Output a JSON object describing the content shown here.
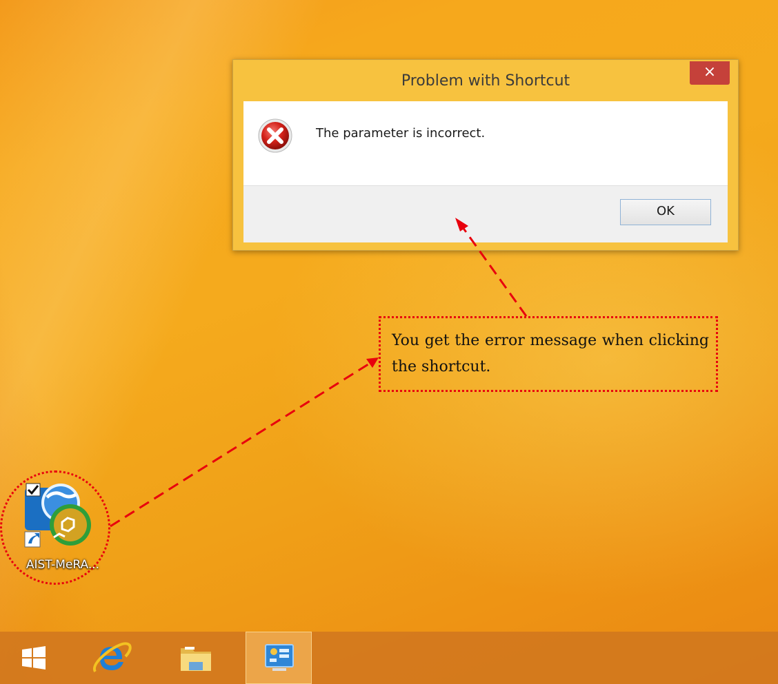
{
  "dialog": {
    "title": "Problem with Shortcut",
    "close_glyph": "×",
    "message": "The parameter is incorrect.",
    "ok_label": "OK",
    "icon": "error-icon"
  },
  "annotation": {
    "text": "You get the error message when clicking the shortcut."
  },
  "desktop": {
    "shortcut_label": "AIST-MeRA..."
  },
  "taskbar": {
    "items": [
      {
        "name": "start",
        "icon": "windows-logo-icon"
      },
      {
        "name": "internet-explorer",
        "icon": "internet-explorer-icon"
      },
      {
        "name": "file-explorer",
        "icon": "folder-icon"
      },
      {
        "name": "control-panel",
        "icon": "control-panel-icon",
        "active": true
      }
    ]
  },
  "colors": {
    "desktop_bg": "#f5aa1d",
    "dialog_frame": "#f7c23f",
    "close_button": "#c5413a",
    "annotation_red": "#e8000d"
  }
}
